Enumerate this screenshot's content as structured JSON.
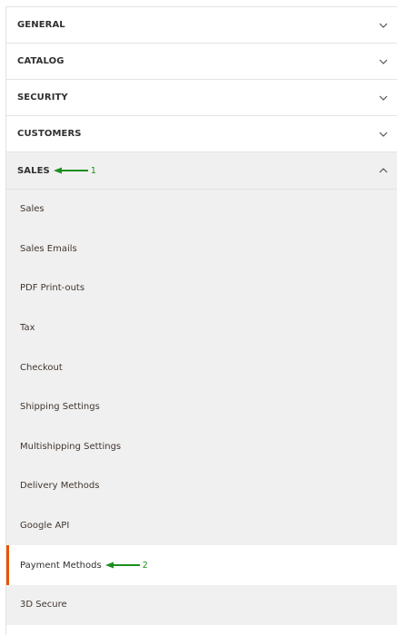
{
  "sections": [
    {
      "label": "GENERAL"
    },
    {
      "label": "CATALOG"
    },
    {
      "label": "SECURITY"
    },
    {
      "label": "CUSTOMERS"
    }
  ],
  "sales": {
    "label": "SALES",
    "annotation": "1",
    "items": [
      {
        "label": "Sales"
      },
      {
        "label": "Sales Emails"
      },
      {
        "label": "PDF Print-outs"
      },
      {
        "label": "Tax"
      },
      {
        "label": "Checkout"
      },
      {
        "label": "Shipping Settings"
      },
      {
        "label": "Multishipping Settings"
      },
      {
        "label": "Delivery Methods"
      },
      {
        "label": "Google API"
      },
      {
        "label": "Payment Methods",
        "annotation": "2"
      },
      {
        "label": "3D Secure"
      }
    ]
  },
  "colors": {
    "active_border": "#eb5202",
    "annotation_arrow": "#1e8e1e",
    "open_background": "#f0f0f0"
  },
  "icons": {
    "collapsed": "chevron-down-icon",
    "expanded": "chevron-up-icon"
  }
}
